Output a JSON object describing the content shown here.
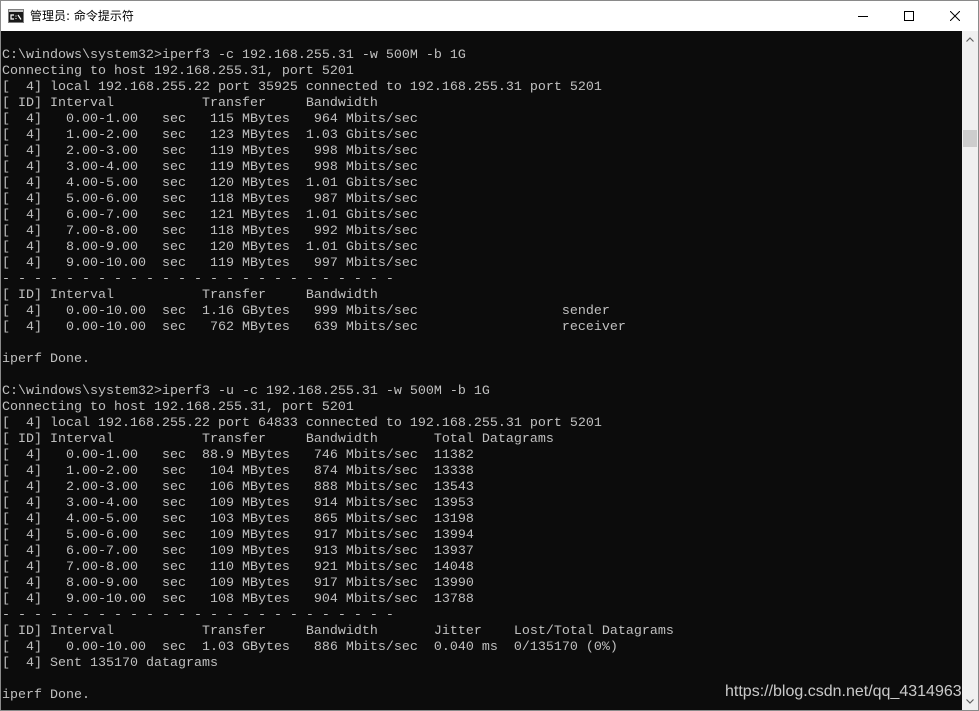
{
  "window": {
    "title": "管理员: 命令提示符",
    "icon": "cmd-icon",
    "controls": {
      "minimize": "minimize-icon",
      "maximize": "maximize-icon",
      "close": "close-icon"
    }
  },
  "console": {
    "background": "#0c0c0c",
    "text_color": "#c0c0c0",
    "lines": [
      "C:\\windows\\system32>iperf3 -c 192.168.255.31 -w 500M -b 1G",
      "Connecting to host 192.168.255.31, port 5201",
      "[  4] local 192.168.255.22 port 35925 connected to 192.168.255.31 port 5201",
      "[ ID] Interval           Transfer     Bandwidth",
      "[  4]   0.00-1.00   sec   115 MBytes   964 Mbits/sec",
      "[  4]   1.00-2.00   sec   123 MBytes  1.03 Gbits/sec",
      "[  4]   2.00-3.00   sec   119 MBytes   998 Mbits/sec",
      "[  4]   3.00-4.00   sec   119 MBytes   998 Mbits/sec",
      "[  4]   4.00-5.00   sec   120 MBytes  1.01 Gbits/sec",
      "[  4]   5.00-6.00   sec   118 MBytes   987 Mbits/sec",
      "[  4]   6.00-7.00   sec   121 MBytes  1.01 Gbits/sec",
      "[  4]   7.00-8.00   sec   118 MBytes   992 Mbits/sec",
      "[  4]   8.00-9.00   sec   120 MBytes  1.01 Gbits/sec",
      "[  4]   9.00-10.00  sec   119 MBytes   997 Mbits/sec",
      "- - - - - - - - - - - - - - - - - - - - - - - - -",
      "[ ID] Interval           Transfer     Bandwidth",
      "[  4]   0.00-10.00  sec  1.16 GBytes   999 Mbits/sec                  sender",
      "[  4]   0.00-10.00  sec   762 MBytes   639 Mbits/sec                  receiver",
      "",
      "iperf Done.",
      "",
      "C:\\windows\\system32>iperf3 -u -c 192.168.255.31 -w 500M -b 1G",
      "Connecting to host 192.168.255.31, port 5201",
      "[  4] local 192.168.255.22 port 64833 connected to 192.168.255.31 port 5201",
      "[ ID] Interval           Transfer     Bandwidth       Total Datagrams",
      "[  4]   0.00-1.00   sec  88.9 MBytes   746 Mbits/sec  11382",
      "[  4]   1.00-2.00   sec   104 MBytes   874 Mbits/sec  13338",
      "[  4]   2.00-3.00   sec   106 MBytes   888 Mbits/sec  13543",
      "[  4]   3.00-4.00   sec   109 MBytes   914 Mbits/sec  13953",
      "[  4]   4.00-5.00   sec   103 MBytes   865 Mbits/sec  13198",
      "[  4]   5.00-6.00   sec   109 MBytes   917 Mbits/sec  13994",
      "[  4]   6.00-7.00   sec   109 MBytes   913 Mbits/sec  13937",
      "[  4]   7.00-8.00   sec   110 MBytes   921 Mbits/sec  14048",
      "[  4]   8.00-9.00   sec   109 MBytes   917 Mbits/sec  13990",
      "[  4]   9.00-10.00  sec   108 MBytes   904 Mbits/sec  13788",
      "- - - - - - - - - - - - - - - - - - - - - - - - -",
      "[ ID] Interval           Transfer     Bandwidth       Jitter    Lost/Total Datagrams",
      "[  4]   0.00-10.00  sec  1.03 GBytes   886 Mbits/sec  0.040 ms  0/135170 (0%)",
      "[  4] Sent 135170 datagrams",
      "",
      "iperf Done."
    ]
  },
  "scrollbar": {
    "position": 0.13,
    "up_icon": "chevron-up-icon",
    "down_icon": "chevron-down-icon"
  },
  "watermark": "https://blog.csdn.net/qq_4314963"
}
